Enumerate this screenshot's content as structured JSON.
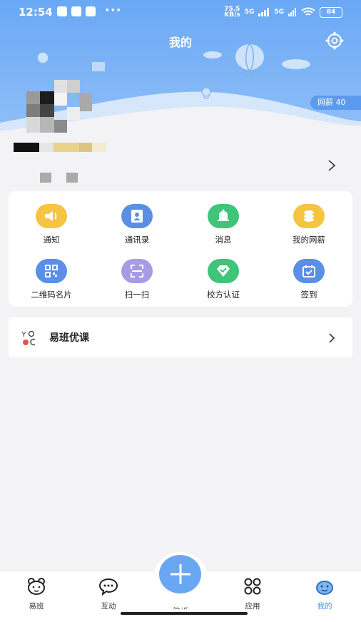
{
  "status_bar": {
    "time": "12:54",
    "dots": "···",
    "network_speed": "75.5\nKB/s",
    "signal1": "5G",
    "signal2": "5G",
    "battery": "84"
  },
  "header": {
    "title": "我的",
    "points_badge": "网薪 40"
  },
  "colors": {
    "header_blue": "#6aa8f5",
    "accent": "#4a8fe8",
    "tile_yellow": "#f5c443",
    "tile_blue": "#5b8fe6",
    "tile_green": "#3fc47a",
    "tile_purple": "#a79be6"
  },
  "grid": [
    {
      "label": "通知",
      "icon": "speaker-icon"
    },
    {
      "label": "通讯录",
      "icon": "contacts-icon"
    },
    {
      "label": "消息",
      "icon": "bell-icon"
    },
    {
      "label": "我的网薪",
      "icon": "coins-icon"
    },
    {
      "label": "二维码名片",
      "icon": "qr-code-icon"
    },
    {
      "label": "扫一扫",
      "icon": "scan-icon"
    },
    {
      "label": "校方认证",
      "icon": "verified-icon"
    },
    {
      "label": "签到",
      "icon": "calendar-check-icon"
    }
  ],
  "course": {
    "label": "易班优课",
    "logo_text": "YOC"
  },
  "tabs": [
    {
      "label": "易班",
      "icon": "bear-icon"
    },
    {
      "label": "互动",
      "icon": "chat-icon"
    },
    {
      "label": "发布",
      "icon": "plus-icon"
    },
    {
      "label": "应用",
      "icon": "apps-icon"
    },
    {
      "label": "我的",
      "icon": "profile-icon"
    }
  ]
}
